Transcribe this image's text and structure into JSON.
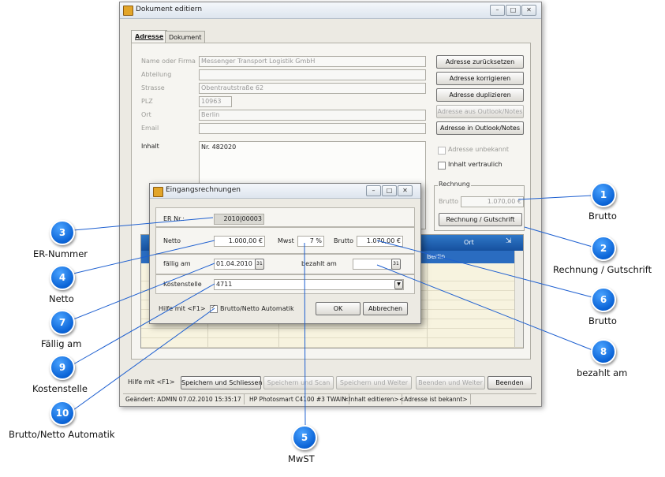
{
  "main_window": {
    "title": "Dokument editiern",
    "controls": {
      "minimize": "–",
      "maximize": "□",
      "close": "✕"
    },
    "tabs": [
      "Adresse",
      "Dokument"
    ],
    "fields": {
      "name_label": "Name oder Firma",
      "name_value": "Messenger Transport Logistik GmbH",
      "abteilung_label": "Abteilung",
      "abteilung_value": "",
      "strasse_label": "Strasse",
      "strasse_value": "Obentrautstraße 62",
      "plz_label": "PLZ",
      "plz_value": "10963",
      "ort_label": "Ort",
      "ort_value": "Berlin",
      "email_label": "Email",
      "email_value": "",
      "inhalt_label": "Inhalt",
      "inhalt_value": "Nr. 482020"
    },
    "buttons": {
      "reset": "Adresse zurücksetzen",
      "correct": "Adresse korrigieren",
      "duplicate": "Adresse duplizieren",
      "from_outlook": "Adresse aus Outlook/Notes",
      "to_outlook": "Adresse in Outlook/Notes"
    },
    "checks": {
      "unknown": "Adresse unbekannt",
      "confidential": "Inhalt vertraulich"
    },
    "rechnung": {
      "group_label": "Rechnung",
      "brutto_label": "Brutto",
      "brutto_value": "1.070,00 €",
      "button": "Rechnung / Gutschrift"
    },
    "grid": {
      "ort_header": "Ort",
      "row_city": "Berlin"
    },
    "footer": {
      "help": "Hilfe mit <F1>",
      "save_close": "Speichern und Schliessen",
      "save_scan": "Speichern und Scan",
      "save_next": "Speichern und Weiter",
      "end_next": "Beenden und Weiter",
      "end": "Beenden"
    },
    "status": [
      "Geändert: ADMIN 07.02.2010 15:35:17",
      "HP Photosmart C4100 #3 TWAIN",
      "<Inhalt editieren>",
      "<Adresse ist bekannt>"
    ]
  },
  "dialog": {
    "title": "Eingangsrechnungen",
    "er_label": "ER Nr.:",
    "er_value": "2010|00003",
    "netto_label": "Netto",
    "netto_value": "1.000,00 €",
    "mwst_label": "Mwst",
    "mwst_value": "7 %",
    "brutto_label": "Brutto",
    "brutto_value": "1.070,00 €",
    "faellig_label": "fällig am",
    "faellig_value": "01.04.2010",
    "bezahlt_label": "bezahlt am",
    "bezahlt_value": "",
    "kostenstelle_label": "Kostenstelle",
    "kostenstelle_value": "4711",
    "help": "Hilfe mit <F1>",
    "auto_check_label": "Brutto/Netto Automatik",
    "ok": "OK",
    "cancel": "Abbrechen"
  },
  "callouts": [
    {
      "num": "1",
      "text": "Brutto"
    },
    {
      "num": "2",
      "text": "Rechnung / Gutschrift"
    },
    {
      "num": "3",
      "text": "ER-Nummer"
    },
    {
      "num": "4",
      "text": "Netto"
    },
    {
      "num": "5",
      "text": "MwST"
    },
    {
      "num": "6",
      "text": "Brutto"
    },
    {
      "num": "7",
      "text": "Fällig am"
    },
    {
      "num": "8",
      "text": "bezahlt am"
    },
    {
      "num": "9",
      "text": "Kostenstelle"
    },
    {
      "num": "10",
      "text": "Brutto/Netto Automatik"
    }
  ],
  "colors": {
    "callout": "#0a63d6",
    "grid_header": "#1f5fb0",
    "grid_row": "#f7f3df"
  }
}
